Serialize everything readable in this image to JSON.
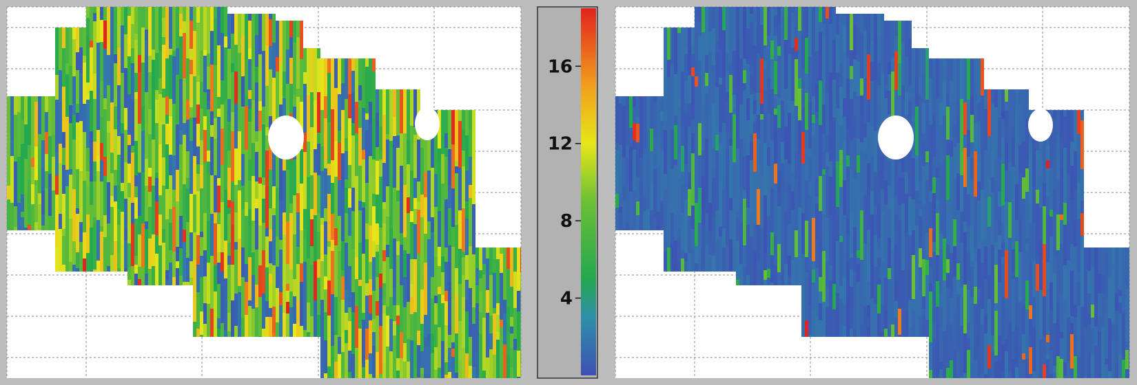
{
  "chart_data": {
    "type": "heatmap",
    "title": "",
    "panels": [
      {
        "name": "",
        "predominant_range": [
          3,
          16
        ],
        "dominant_color_band": "green-yellow",
        "holes": 2
      },
      {
        "name": "",
        "predominant_range": [
          0,
          2
        ],
        "dominant_color_band": "blue",
        "holes": 2
      }
    ],
    "colorbar": {
      "vmin": 0,
      "vmax": 19,
      "ticks": [
        4,
        8,
        12,
        16
      ],
      "tick_labels": [
        "4",
        "8",
        "12",
        "16"
      ],
      "stops": [
        {
          "value": 0,
          "color": "#3d50b4"
        },
        {
          "value": 3,
          "color": "#2f8fa8"
        },
        {
          "value": 5,
          "color": "#23a850"
        },
        {
          "value": 9,
          "color": "#6cc034"
        },
        {
          "value": 12,
          "color": "#e6e619"
        },
        {
          "value": 15,
          "color": "#f29e1c"
        },
        {
          "value": 19,
          "color": "#e2231f"
        }
      ]
    },
    "grid": true
  },
  "colors": {
    "background": "#bdbdbd",
    "plot_bg": "#ffffff",
    "grid": "#8a8a8a",
    "colorbar_bg": "#b2b2b2"
  }
}
